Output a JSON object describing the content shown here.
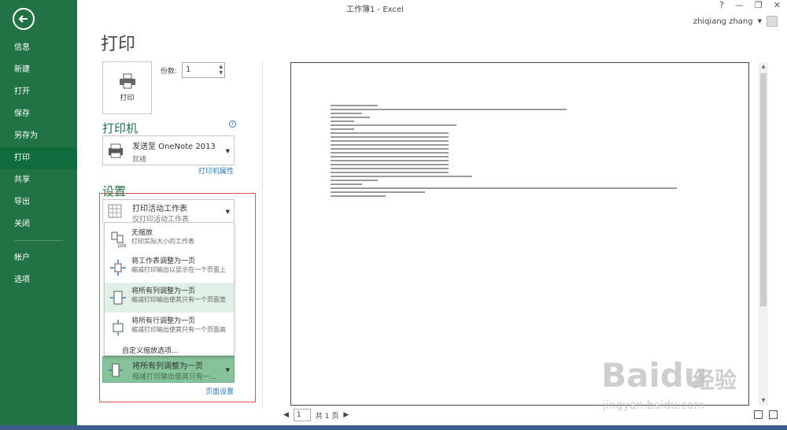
{
  "window": {
    "title": "工作簿1 - Excel",
    "help": "?",
    "user": "zhiqiang zhang"
  },
  "sidebar": {
    "items": [
      {
        "label": "信息"
      },
      {
        "label": "新建"
      },
      {
        "label": "打开"
      },
      {
        "label": "保存"
      },
      {
        "label": "另存为"
      },
      {
        "label": "打印"
      },
      {
        "label": "共享"
      },
      {
        "label": "导出"
      },
      {
        "label": "关闭"
      },
      {
        "label": "帐户"
      },
      {
        "label": "选项"
      }
    ],
    "active": "打印"
  },
  "print": {
    "page_title": "打印",
    "print_button": "打印",
    "copies_label": "份数:",
    "copies_value": "1"
  },
  "printer": {
    "heading": "打印机",
    "name": "发送至 OneNote 2013",
    "status": "就绪",
    "properties_link": "打印机属性"
  },
  "settings": {
    "heading": "设置",
    "scope_title": "打印活动工作表",
    "scope_sub": "仅打印活动工作表",
    "scaling_menu": [
      {
        "title": "无缩放",
        "sub": "打印实际大小的工作表"
      },
      {
        "title": "将工作表调整为一页",
        "sub": "缩减打印输出以显示在一个页面上"
      },
      {
        "title": "将所有列调整为一页",
        "sub": "缩减打印输出使其只有一个页面宽"
      },
      {
        "title": "将所有行调整为一页",
        "sub": "缩减打印输出使其只有一个页面高"
      }
    ],
    "custom_scaling": "自定义缩放选项...",
    "scaling_selected_title": "将所有列调整为一页",
    "scaling_selected_sub": "缩减打印输出使其只有一...",
    "page_setup_link": "页面设置"
  },
  "preview": {
    "page_number": "1",
    "page_total": "共 1 页"
  },
  "watermark": {
    "brand": "Baidu",
    "cn": "经验",
    "url": "jingyan.baidu.com"
  },
  "colors": {
    "sidebar_bg": "#217346",
    "accent_green": "#217346",
    "link_blue": "#2a78c0",
    "highlight_border": "#e05252"
  }
}
